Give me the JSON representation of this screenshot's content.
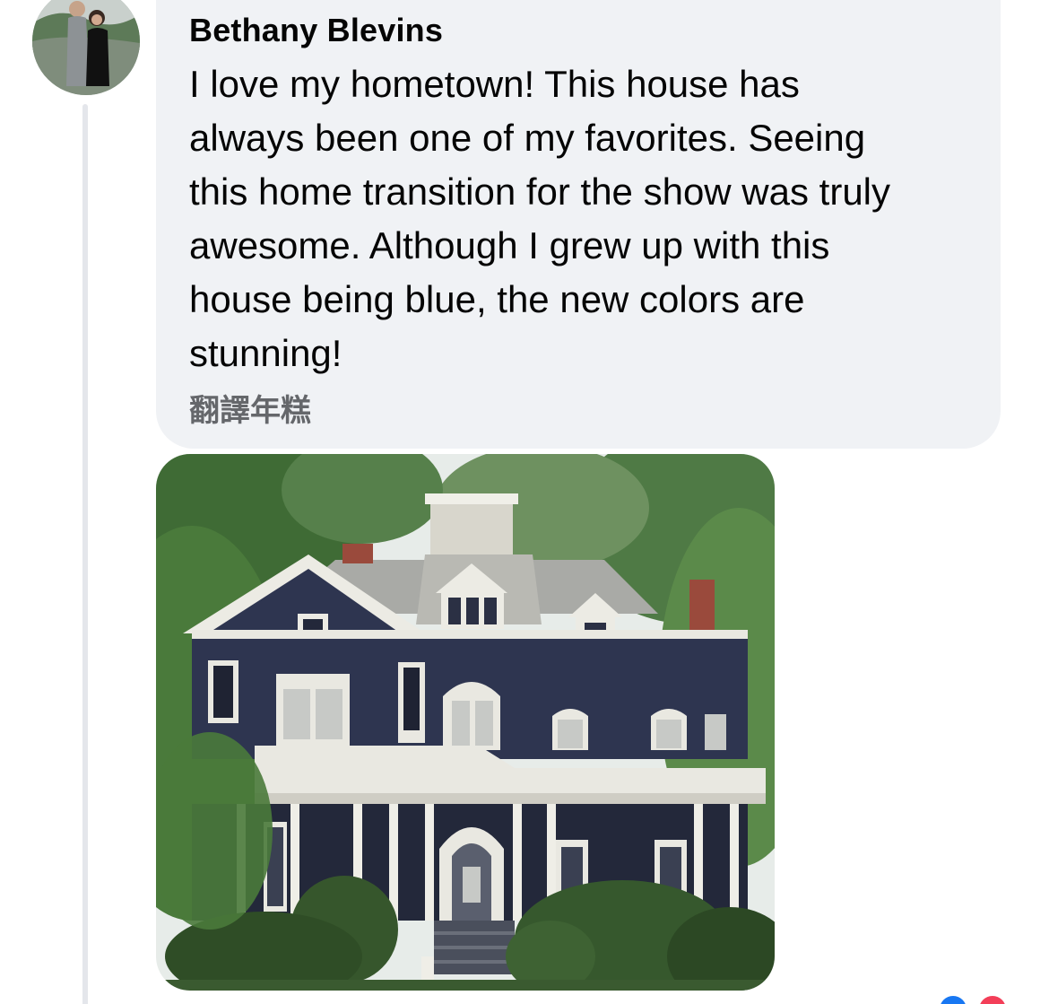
{
  "comment": {
    "author": "Bethany Blevins",
    "text_lines": [
      "I love my hometown! This house has",
      "always been one of my favorites. Seeing",
      "this home transition for the show was truly",
      "awesome. Although I grew up with this",
      "house being blue, the new colors are",
      "stunning!"
    ],
    "translate_label": "翻譯年糕"
  },
  "colors": {
    "bubble_background": "#f0f2f5",
    "text_primary": "#050505",
    "text_secondary": "#65676b",
    "thread_line": "#e4e6eb",
    "house_siding": "#2e3550",
    "house_trim": "#e9e8e1"
  },
  "icons": {
    "avatar": "profile-photo-avatar",
    "photo": "victorian-house-photo"
  }
}
